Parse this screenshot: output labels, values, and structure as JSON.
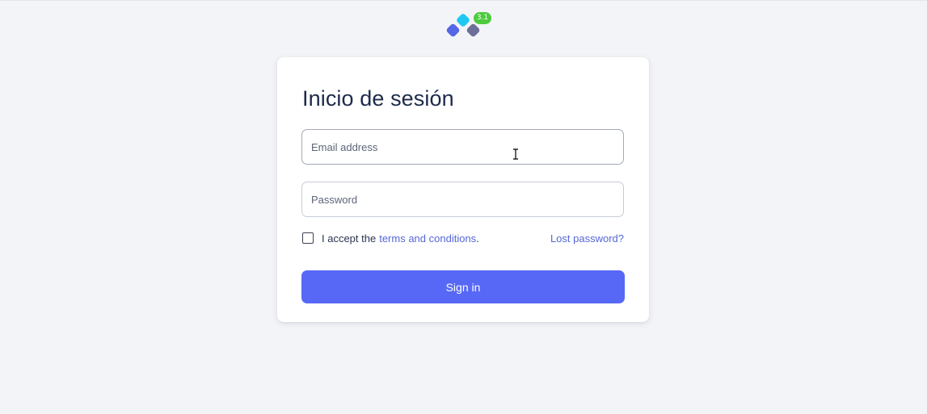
{
  "app": {
    "logo_icon": "app-logo-icon",
    "version_badge": "3.1"
  },
  "login": {
    "title": "Inicio de sesión",
    "email_placeholder": "Email address",
    "password_placeholder": "Password",
    "accept_prefix": "I accept the",
    "terms_label": "terms and conditions",
    "accept_suffix": ".",
    "lost_password_label": "Lost password?",
    "signin_label": "Sign in",
    "terms_accepted": false
  },
  "colors": {
    "accent": "#5768f6",
    "link": "#5567d8",
    "badge": "#4ccb3d",
    "background": "#f3f4f7",
    "title": "#1d2a4a"
  }
}
